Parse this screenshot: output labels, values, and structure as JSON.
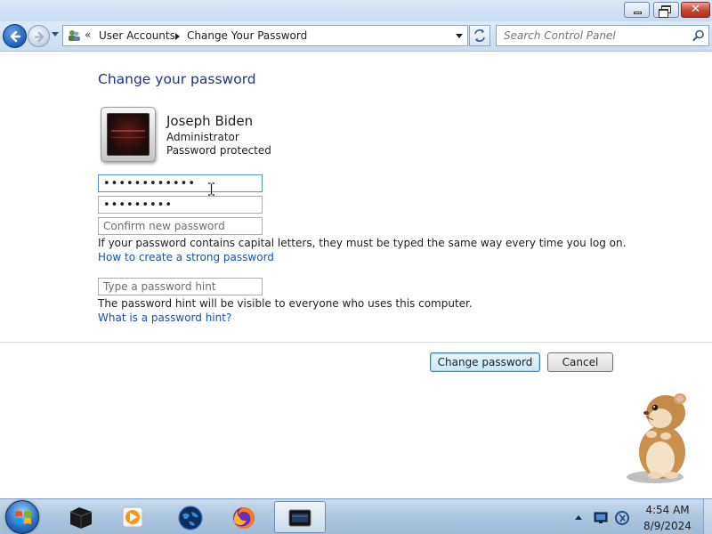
{
  "window": {
    "minimize_label": "",
    "maximize_label": "",
    "close_label": "✕"
  },
  "nav": {
    "breadcrumb_overflow": "«",
    "breadcrumbs": [
      "User Accounts",
      "Change Your Password"
    ],
    "search_placeholder": "Search Control Panel"
  },
  "main": {
    "title": "Change your password",
    "user": {
      "name": "Joseph Biden",
      "role": "Administrator",
      "status": "Password protected"
    },
    "fields": {
      "current_password_value": "••••••••••••",
      "new_password_value": "•••••••••",
      "confirm_placeholder": "Confirm new password",
      "hint_placeholder": "Type a password hint"
    },
    "capital_note": "If your password contains capital letters, they must be typed the same way every time you log on.",
    "strong_link": "How to create a strong password",
    "hint_note": "The password hint will be visible to everyone who uses this computer.",
    "hint_link": "What is a password hint?",
    "buttons": {
      "change": "Change password",
      "cancel": "Cancel"
    }
  },
  "taskbar": {
    "apps": [
      "control-panel-icon",
      "media-player-icon",
      "globe-icon",
      "firefox-icon",
      "active-window-icon"
    ],
    "clock_time": "4:54 AM",
    "clock_date": "8/9/2024"
  },
  "colors": {
    "title_blue": "#1e3287",
    "link_blue": "#1a52a8",
    "taskbar": "#aec7e0"
  }
}
